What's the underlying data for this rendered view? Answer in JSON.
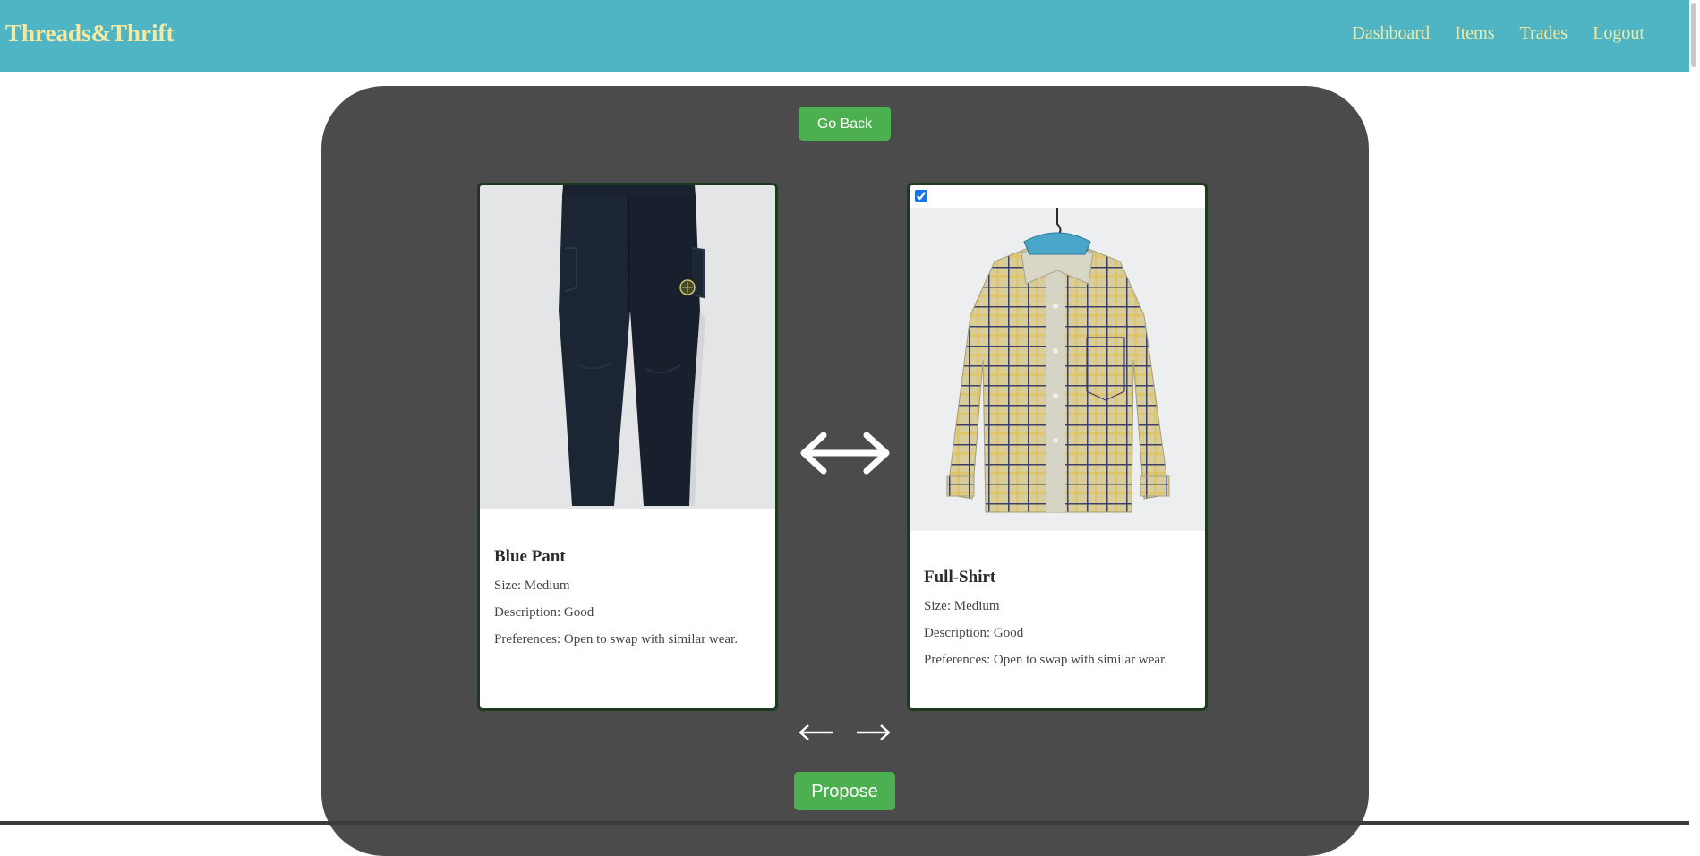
{
  "brand": "Threads&Thrift",
  "nav": [
    "Dashboard",
    "Items",
    "Trades",
    "Logout"
  ],
  "actions": {
    "go_back": "Go Back",
    "propose": "Propose"
  },
  "items": [
    {
      "name": "Blue Pant",
      "size": "Size: Medium",
      "description": "Description: Good",
      "preferences": "Preferences: Open to swap with similar wear.",
      "selected": false,
      "image": "navy cargo pants"
    },
    {
      "name": "Full-Shirt",
      "size": "Size: Medium",
      "description": "Description: Good",
      "preferences": "Preferences: Open to swap with similar wear.",
      "selected": true,
      "image": "plaid long-sleeve shirt on hanger"
    }
  ],
  "icons": {
    "swap": "double-arrow-icon",
    "prev": "arrow-left-icon",
    "next": "arrow-right-icon"
  },
  "colors": {
    "navbar": "#4fb5c4",
    "brand_text": "#f3e9a3",
    "panel": "#4b4b4b",
    "button": "#4caf50",
    "card_border": "#1d3a1f"
  }
}
